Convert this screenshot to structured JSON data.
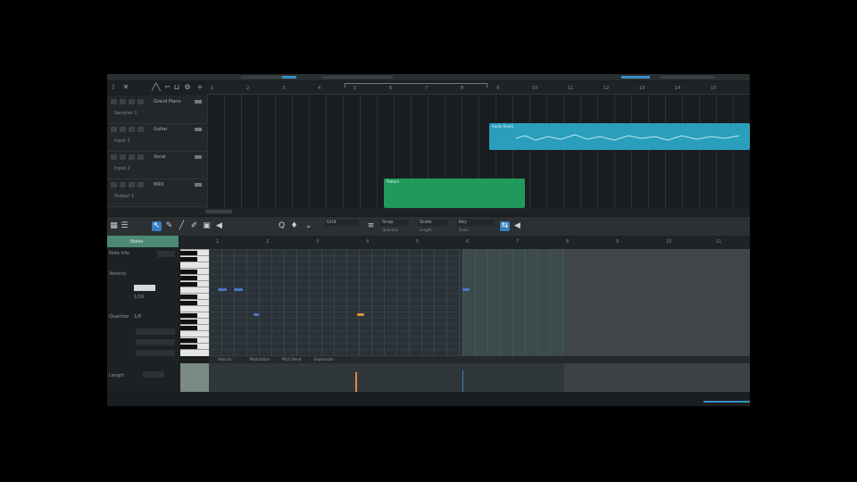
{
  "colors": {
    "accent": "#3a7fc0",
    "audio_clip": "#2a9fbd",
    "midi_clip": "#1f9a5b",
    "note_blue": "#4a78c8",
    "note_orange": "#e08a3a",
    "panel_green": "#4c8a76"
  },
  "arrangement": {
    "ruler_numbers": [
      "1",
      "2",
      "3",
      "4",
      "5",
      "6",
      "7",
      "8",
      "9",
      "10",
      "11",
      "12",
      "13",
      "14",
      "15"
    ],
    "tracks": [
      {
        "name": "Grand Piano",
        "sub": "Sampler 1"
      },
      {
        "name": "Guitar",
        "sub": "Input 1"
      },
      {
        "name": "Vocal",
        "sub": "Input 2"
      },
      {
        "name": "MIDI",
        "sub": "Output 1"
      }
    ],
    "clips": [
      {
        "label": "Audio Event"
      },
      {
        "label": "Pattern"
      }
    ]
  },
  "editor": {
    "panel_tab": "Notes",
    "panel_rows": [
      "Note Info",
      "Velocity",
      "Quantize",
      "Length"
    ],
    "quantize_value": "1/16",
    "length_value": "1/8",
    "field_labels": [
      "Grid",
      "Snap",
      "Scale",
      "Key"
    ],
    "field_subs": [
      "Quantize",
      "Length",
      "Scale"
    ],
    "ruler_numbers": [
      "1",
      "2",
      "3",
      "4",
      "5",
      "6",
      "7",
      "8",
      "9",
      "10",
      "11"
    ],
    "velocity_tabs": [
      "Velocity",
      "Modulation",
      "Pitch Bend",
      "Expression"
    ],
    "tool_icons": [
      "arrow-icon",
      "pencil-icon",
      "eraser-icon",
      "paint-icon",
      "mute-icon",
      "speaker-icon",
      "zoom-icon",
      "chevron-down-icon",
      "loop-icon"
    ]
  }
}
